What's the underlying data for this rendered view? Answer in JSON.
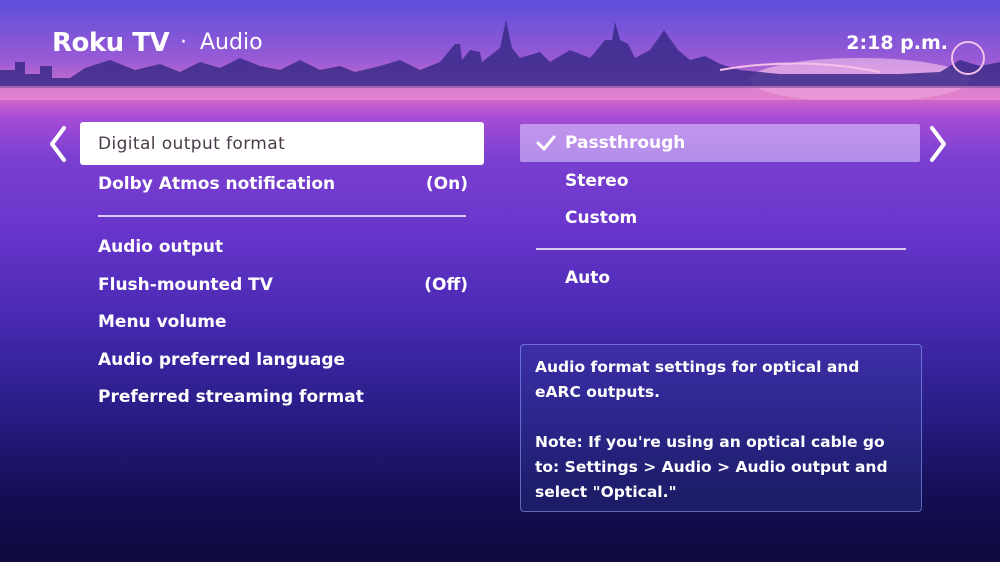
{
  "header": {
    "brand": "Roku TV",
    "separator": "·",
    "title": "Audio",
    "time": "2:18 p.m."
  },
  "left_menu": {
    "selected": {
      "label": "Digital output format"
    },
    "items_top": [
      {
        "label": "Dolby Atmos notification",
        "value": "(On)"
      }
    ],
    "items_bottom": [
      {
        "label": "Audio output",
        "value": ""
      },
      {
        "label": "Flush-mounted TV",
        "value": "(Off)"
      },
      {
        "label": "Menu volume",
        "value": ""
      },
      {
        "label": "Audio preferred language",
        "value": ""
      },
      {
        "label": "Preferred streaming format",
        "value": ""
      }
    ]
  },
  "right_menu": {
    "options": [
      {
        "label": "Passthrough",
        "checked": true
      },
      {
        "label": "Stereo",
        "checked": false
      },
      {
        "label": "Custom",
        "checked": false
      }
    ],
    "extra": [
      {
        "label": "Auto"
      }
    ]
  },
  "description": {
    "line1": "Audio format settings for optical and eARC outputs.",
    "line2": "Note: If you're using an optical cable go to: Settings > Audio > Audio output and select \"Optical.\""
  },
  "icons": {
    "left_nav": "chevron-left-icon",
    "right_nav": "chevron-right-icon",
    "check": "checkmark-icon"
  },
  "colors": {
    "selected_bg": "#ffffff",
    "selected_text": "#4a3b4a",
    "accent_purple": "#7a3fd0"
  }
}
